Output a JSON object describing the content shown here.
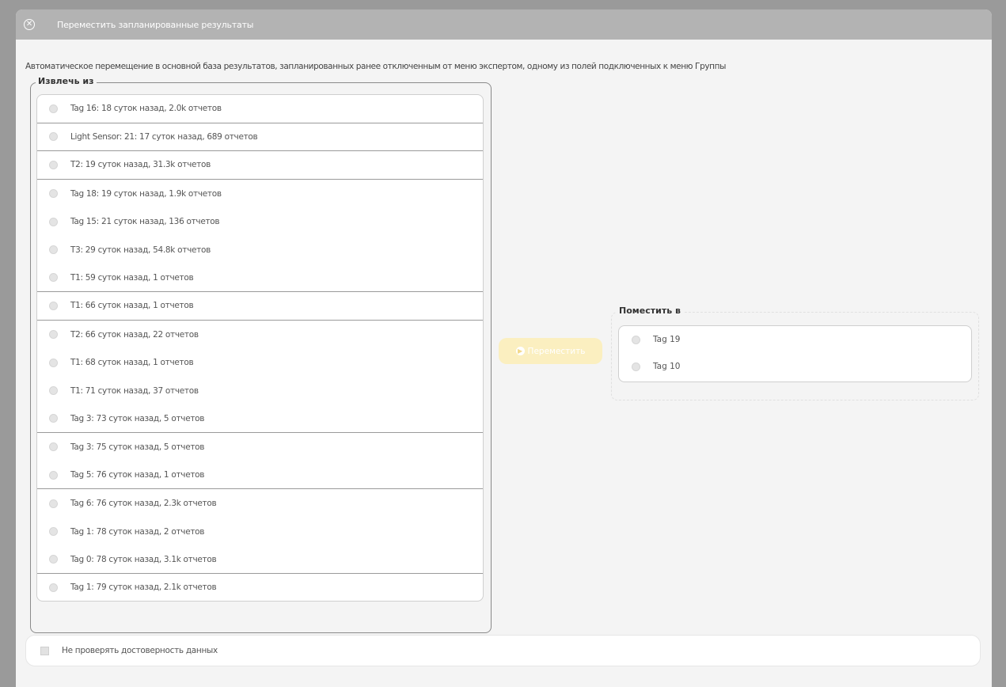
{
  "dialog": {
    "title": "Переместить запланированные результаты"
  },
  "description": "Автоматическое перемещение в основной база результатов, запланированных ранее отключенным от меню экспертом, одному из полей подключенных к меню Группы",
  "from": {
    "legend": "Извлечь из",
    "items": [
      {
        "label": "Tag 16: 18 суток назад, 2.0k отчетов"
      },
      {
        "label": "Light Sensor: 21: 17 суток назад, 689 отчетов"
      },
      {
        "label": "T2: 19 суток назад, 31.3k отчетов"
      },
      {
        "label": "Tag 18: 19 суток назад, 1.9k отчетов"
      },
      {
        "label": "Tag 15: 21 суток назад, 136 отчетов"
      },
      {
        "label": "T3: 29 суток назад, 54.8k отчетов"
      },
      {
        "label": "T1: 59 суток назад, 1 отчетов"
      },
      {
        "label": "T1: 66 суток назад, 1 отчетов"
      },
      {
        "label": "T2: 66 суток назад, 22 отчетов"
      },
      {
        "label": "T1: 68 суток назад, 1 отчетов"
      },
      {
        "label": "T1: 71 суток назад, 37 отчетов"
      },
      {
        "label": "Tag 3: 73 суток назад, 5 отчетов"
      },
      {
        "label": "Tag 3: 75 суток назад, 5 отчетов"
      },
      {
        "label": "Tag 5: 76 суток назад, 1 отчетов"
      },
      {
        "label": "Tag 6: 76 суток назад, 2.3k отчетов"
      },
      {
        "label": "Tag 1: 78 суток назад, 2 отчетов"
      },
      {
        "label": "Tag 0: 78 суток назад, 3.1k отчетов"
      },
      {
        "label": "Tag 1: 79 суток назад, 2.1k отчетов"
      }
    ]
  },
  "move_button": {
    "label": "Переместить",
    "icon": "arrow-right-icon"
  },
  "to": {
    "legend": "Поместить в",
    "items": [
      {
        "label": "Tag 19"
      },
      {
        "label": "Tag 10"
      }
    ]
  },
  "verify": {
    "label": "Не проверять достоверность данных"
  },
  "colors": {
    "titlebar": "#b3b3b3",
    "button_disabled": "#fbefc0",
    "background": "#f4f4f4"
  }
}
